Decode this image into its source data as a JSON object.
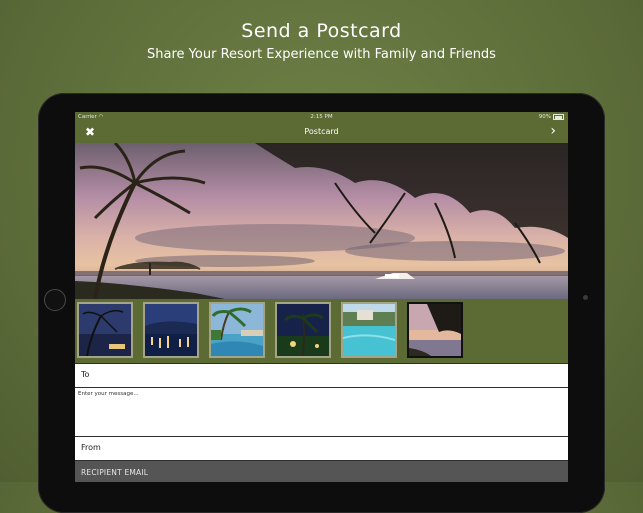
{
  "promo": {
    "title": "Send a Postcard",
    "subtitle": "Share Your Resort Experience with Family and Friends"
  },
  "status_bar": {
    "carrier": "Carrier",
    "time": "2:15 PM",
    "battery": "90%"
  },
  "navbar": {
    "title": "Postcard",
    "close_icon": "close-icon",
    "next_icon": "chevron-right-icon"
  },
  "thumbnails": [
    {
      "name": "palm-tree-sunset-night",
      "selected": false
    },
    {
      "name": "harbor-night-lights",
      "selected": false
    },
    {
      "name": "pool-palm-trees",
      "selected": false
    },
    {
      "name": "garden-night",
      "selected": false
    },
    {
      "name": "infinity-pool-view",
      "selected": false
    },
    {
      "name": "sunset-shore",
      "selected": true
    }
  ],
  "form": {
    "to_label": "To",
    "message_placeholder": "Enter your message...",
    "from_label": "From",
    "recipient_email_label": "RECIPIENT EMAIL"
  },
  "colors": {
    "background": "#5e6e3a",
    "nav_bar": "#5c6a34",
    "recipient_bar": "#555555"
  }
}
